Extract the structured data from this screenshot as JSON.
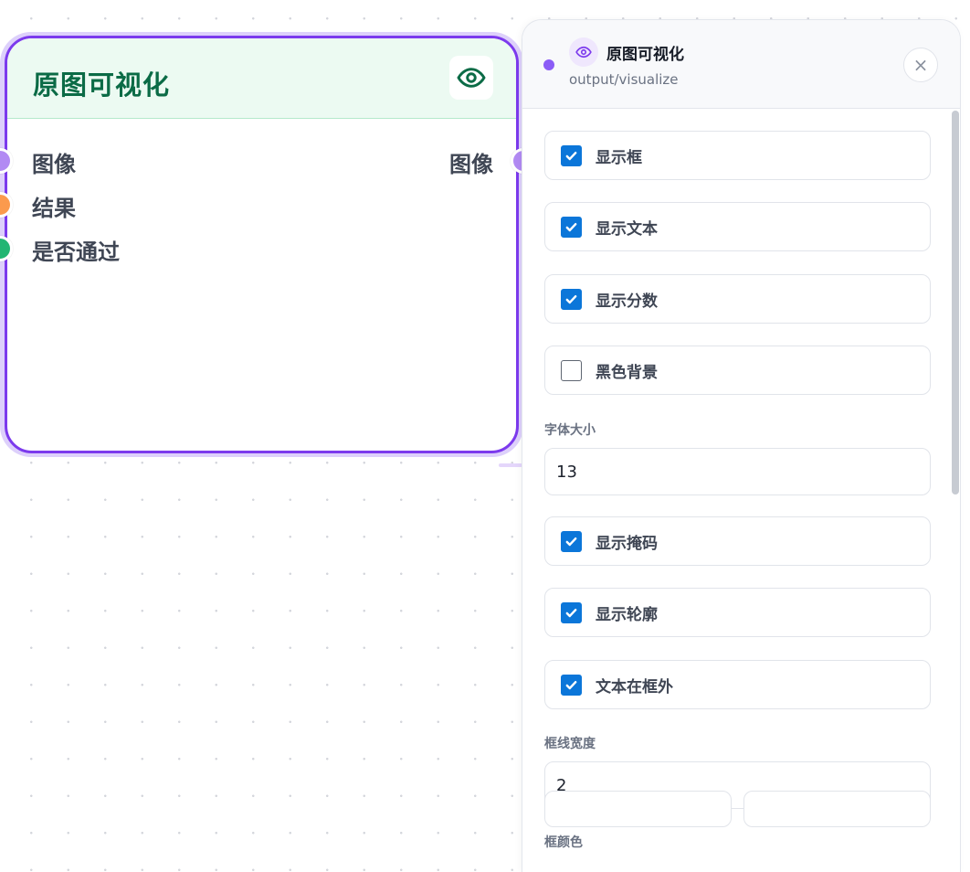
{
  "node": {
    "title": "原图可视化",
    "icon": "eye-icon",
    "accent_color": "#7c3aed",
    "inputs": [
      {
        "label": "图像",
        "color": "#b28af3"
      },
      {
        "label": "结果",
        "color": "#fb9a4d"
      },
      {
        "label": "是否通过",
        "color": "#22b573"
      }
    ],
    "outputs": [
      {
        "label": "图像",
        "color": "#b28af3"
      }
    ]
  },
  "panel": {
    "title": "原图可视化",
    "subtitle": "output/visualize",
    "header_icon": "eye-icon",
    "close_icon": "close-icon",
    "close_glyph": "×",
    "options": [
      {
        "label": "显示框",
        "checked": true
      },
      {
        "label": "显示文本",
        "checked": true
      },
      {
        "label": "显示分数",
        "checked": true
      },
      {
        "label": "黑色背景",
        "checked": false
      }
    ],
    "font_size": {
      "label": "字体大小",
      "value": "13"
    },
    "options2": [
      {
        "label": "显示掩码",
        "checked": true
      },
      {
        "label": "显示轮廓",
        "checked": true
      },
      {
        "label": "文本在框外",
        "checked": true
      }
    ],
    "line_width": {
      "label": "框线宽度",
      "value": "2"
    },
    "box_color": {
      "label": "框颜色"
    }
  }
}
